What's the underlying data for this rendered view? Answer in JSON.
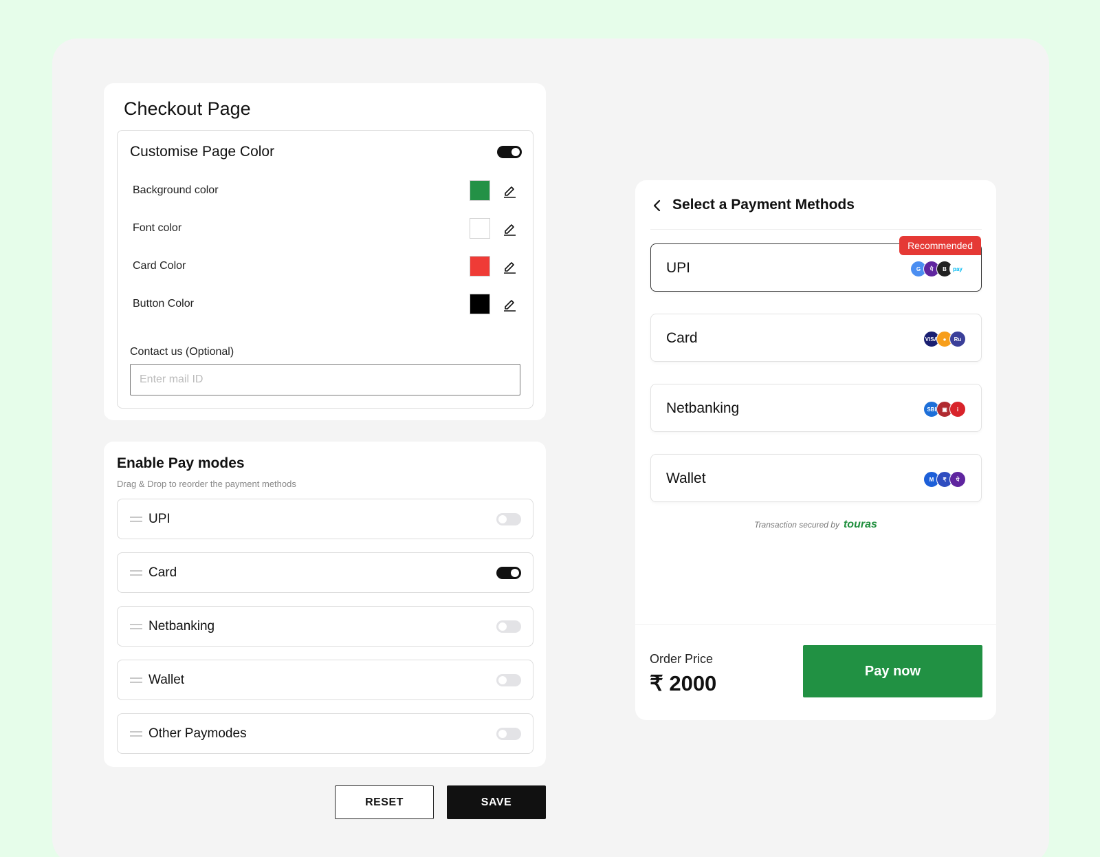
{
  "checkout": {
    "title": "Checkout Page",
    "customise": {
      "title": "Customise Page Color",
      "enabled": true,
      "colors": [
        {
          "label": "Background color",
          "value": "#239146"
        },
        {
          "label": "Font color",
          "value": "#ffffff"
        },
        {
          "label": "Card Color",
          "value": "#ef3b36"
        },
        {
          "label": "Button Color",
          "value": "#000000"
        }
      ],
      "contact_label": "Contact us (Optional)",
      "contact_placeholder": "Enter mail ID",
      "contact_value": ""
    }
  },
  "paymodes": {
    "title": "Enable Pay modes",
    "subtitle": "Drag & Drop to reorder the payment methods",
    "items": [
      {
        "label": "UPI",
        "enabled": false
      },
      {
        "label": "Card",
        "enabled": true
      },
      {
        "label": "Netbanking",
        "enabled": false
      },
      {
        "label": "Wallet",
        "enabled": false
      },
      {
        "label": "Other Paymodes",
        "enabled": false
      }
    ]
  },
  "actions": {
    "reset_label": "RESET",
    "save_label": "SAVE"
  },
  "preview": {
    "title": "Select a Payment Methods",
    "methods": [
      {
        "label": "UPI",
        "badge": "Recommended",
        "icons": [
          "google-pay-icon",
          "phonepe-icon",
          "bhim-icon",
          "paytm-icon"
        ]
      },
      {
        "label": "Card",
        "icons": [
          "visa-icon",
          "mastercard-icon",
          "rupay-icon"
        ]
      },
      {
        "label": "Netbanking",
        "icons": [
          "sbi-icon",
          "icici-icon",
          "hdfc-icon"
        ]
      },
      {
        "label": "Wallet",
        "icons": [
          "mobikwik-icon",
          "freecharge-icon",
          "phonepe-wallet-icon"
        ]
      }
    ],
    "secured_text": "Transaction secured by",
    "secured_brand": "touras",
    "order_label": "Order Price",
    "order_price": "₹ 2000",
    "pay_label": "Pay now"
  },
  "colors": {
    "page_bg": "#e6fdea",
    "accent_green": "#219143",
    "recommended_red": "#e53935"
  }
}
